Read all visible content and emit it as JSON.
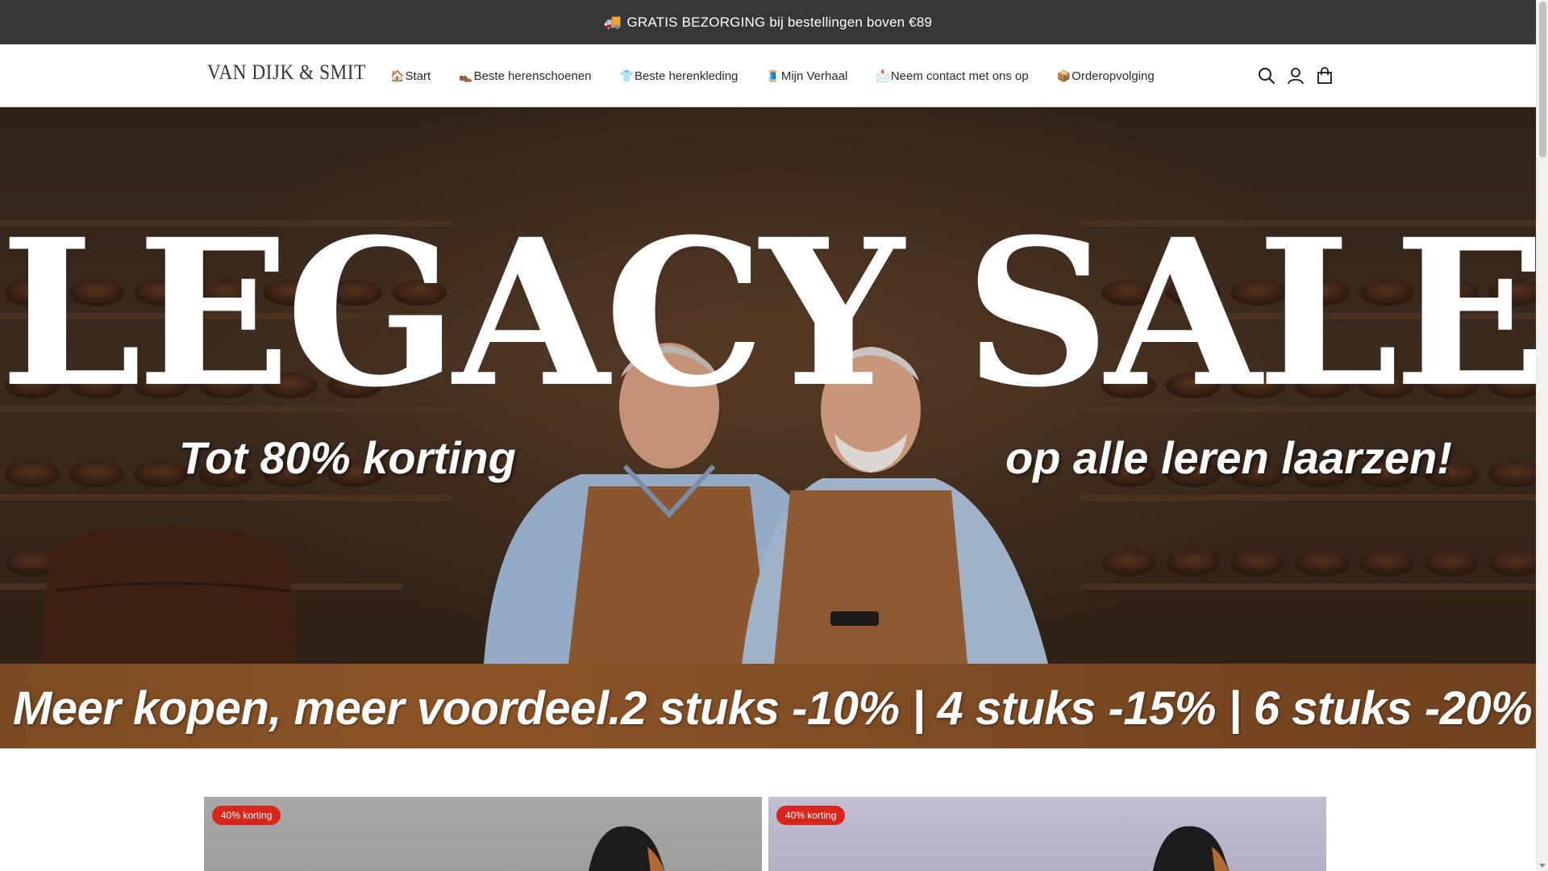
{
  "announcement": {
    "icon": "delivery-truck-icon",
    "text": "GRATIS BEZORGING bij bestellingen boven €89"
  },
  "header": {
    "logo": "VAN DIJK & SMIT",
    "nav": [
      {
        "emoji": "🏠",
        "label": "Start"
      },
      {
        "emoji": "👞",
        "label": "Beste herenschoenen"
      },
      {
        "emoji": "👕",
        "label": "Beste herenkleding"
      },
      {
        "emoji": "🧵",
        "label": "Mijn Verhaal"
      },
      {
        "emoji": "📩",
        "label": "Neem contact met ons op"
      },
      {
        "emoji": "📦",
        "label": "Orderopvolging"
      }
    ],
    "icons": [
      "search-icon",
      "account-icon",
      "cart-bag-icon"
    ]
  },
  "hero": {
    "headline": "LEGACY SALE",
    "sub_left": "Tot 80% korting",
    "sub_right": "op alle leren laarzen!",
    "promo": "Meer kopen, meer voordeel.2 stuks -10% | 4 stuks -15% | 6 stuks -20%"
  },
  "products": [
    {
      "badge": "40% korting"
    },
    {
      "badge": "40% korting"
    }
  ],
  "colors": {
    "announcement_bg": "#373737",
    "badge_red": "#d9261c",
    "promo_brown": "#8b5427"
  }
}
